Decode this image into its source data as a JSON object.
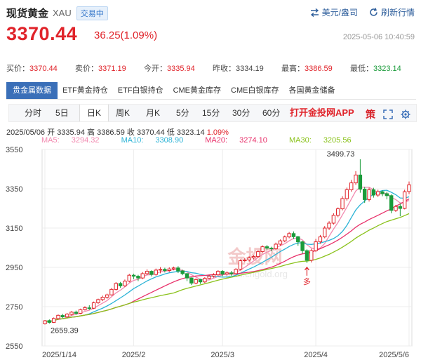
{
  "header": {
    "title": "现货黄金",
    "code": "XAU",
    "status_badge": "交易中",
    "currency_label": "美元/盎司",
    "refresh_label": "刷新行情",
    "last_price": "3370.44",
    "change": "36.25(1.09%)",
    "datetime": "2025-05-06 10:40:59",
    "colors": {
      "up": "#e0232a",
      "down": "#1a9b3a",
      "accent": "#3a6fb8"
    }
  },
  "quotes": {
    "buy_label": "买价：",
    "buy": "3370.44",
    "sell_label": "卖价：",
    "sell": "3371.19",
    "open_label": "今开：",
    "open": "3335.94",
    "prev_label": "昨收：",
    "prev": "3334.19",
    "high_label": "最高：",
    "high": "3386.59",
    "low_label": "最低：",
    "low": "3323.14"
  },
  "tabs": [
    {
      "label": "贵金属数据",
      "active": true
    },
    {
      "label": "ETF黄金持仓"
    },
    {
      "label": "ETF白银持仓"
    },
    {
      "label": "CME黄金库存"
    },
    {
      "label": "CME白银库存"
    },
    {
      "label": "各国黄金储备"
    }
  ],
  "periods": [
    "分时",
    "5日",
    "日K",
    "周K",
    "月K",
    "5分",
    "15分",
    "30分",
    "60分"
  ],
  "active_period": "日K",
  "promo": "打开金投网APP",
  "icons": [
    "ce-icon",
    "fullscreen-icon",
    "settings-icon"
  ],
  "ce_glyph": "策",
  "ohlc": {
    "date": "2025/05/06",
    "open_label": "开",
    "open": "3335.94",
    "high_label": "高",
    "high": "3386.59",
    "close_label": "收",
    "close": "3370.44",
    "low_label": "低",
    "low": "3323.14",
    "change": "1.09%"
  },
  "ma_legend": [
    {
      "label": "MA5:",
      "value": "3294.32",
      "color": "#f28ab0"
    },
    {
      "label": "MA10:",
      "value": "3308.90",
      "color": "#2bb3d6"
    },
    {
      "label": "MA20:",
      "value": "3274.10",
      "color": "#e8306a"
    },
    {
      "label": "MA30:",
      "value": "3205.56",
      "color": "#8ac21b"
    }
  ],
  "watermark": {
    "text": "金投网",
    "sub": "gold.cngold.org"
  },
  "chart_data": {
    "type": "candlestick",
    "y_ticks": [
      "3550",
      "3350",
      "3150",
      "2950",
      "2750",
      "2550"
    ],
    "y_tick_values": [
      3550,
      3350,
      3150,
      2950,
      2750,
      2550
    ],
    "ylim": [
      2550,
      3550
    ],
    "x_ticks": [
      "2025/1/14",
      "2025/2",
      "2025/3",
      "2025/4",
      "2025/5/6"
    ],
    "x_tick_index": [
      0,
      20,
      40,
      61,
      82
    ],
    "max_label": "3499.73",
    "min_label": "2659.39",
    "marker_label": "多",
    "marker_index": 59,
    "candles": [
      [
        2663,
        2678,
        2659,
        2682
      ],
      [
        2679,
        2670,
        2664,
        2685
      ],
      [
        2670,
        2690,
        2667,
        2695
      ],
      [
        2689,
        2706,
        2683,
        2710
      ],
      [
        2705,
        2698,
        2692,
        2714
      ],
      [
        2698,
        2712,
        2693,
        2718
      ],
      [
        2711,
        2722,
        2705,
        2728
      ],
      [
        2722,
        2716,
        2709,
        2730
      ],
      [
        2716,
        2735,
        2712,
        2740
      ],
      [
        2735,
        2745,
        2730,
        2752
      ],
      [
        2744,
        2742,
        2734,
        2757
      ],
      [
        2742,
        2770,
        2738,
        2776
      ],
      [
        2770,
        2786,
        2764,
        2791
      ],
      [
        2786,
        2798,
        2778,
        2806
      ],
      [
        2798,
        2810,
        2790,
        2816
      ],
      [
        2810,
        2838,
        2806,
        2845
      ],
      [
        2838,
        2868,
        2832,
        2875
      ],
      [
        2868,
        2856,
        2846,
        2876
      ],
      [
        2856,
        2880,
        2850,
        2888
      ],
      [
        2880,
        2910,
        2874,
        2917
      ],
      [
        2910,
        2905,
        2890,
        2918
      ],
      [
        2905,
        2896,
        2880,
        2912
      ],
      [
        2896,
        2918,
        2890,
        2926
      ],
      [
        2918,
        2930,
        2910,
        2940
      ],
      [
        2930,
        2914,
        2904,
        2935
      ],
      [
        2914,
        2936,
        2908,
        2944
      ],
      [
        2936,
        2940,
        2920,
        2951
      ],
      [
        2940,
        2934,
        2924,
        2948
      ],
      [
        2934,
        2942,
        2926,
        2950
      ],
      [
        2942,
        2947,
        2935,
        2954
      ],
      [
        2947,
        2932,
        2921,
        2956
      ],
      [
        2932,
        2918,
        2910,
        2938
      ],
      [
        2918,
        2896,
        2880,
        2922
      ],
      [
        2896,
        2870,
        2860,
        2899
      ],
      [
        2870,
        2888,
        2864,
        2894
      ],
      [
        2888,
        2876,
        2866,
        2892
      ],
      [
        2876,
        2894,
        2870,
        2900
      ],
      [
        2894,
        2905,
        2890,
        2912
      ],
      [
        2905,
        2912,
        2898,
        2920
      ],
      [
        2912,
        2930,
        2906,
        2936
      ],
      [
        2930,
        2916,
        2905,
        2936
      ],
      [
        2916,
        2922,
        2908,
        2930
      ],
      [
        2922,
        2918,
        2908,
        2932
      ],
      [
        2918,
        2940,
        2912,
        2946
      ],
      [
        2940,
        2984,
        2934,
        2990
      ],
      [
        2984,
        2988,
        2976,
        2998
      ],
      [
        2988,
        2998,
        2980,
        3006
      ],
      [
        2998,
        3005,
        2990,
        3012
      ],
      [
        3005,
        3030,
        2998,
        3038
      ],
      [
        3030,
        3055,
        3024,
        3062
      ],
      [
        3055,
        3048,
        3040,
        3064
      ],
      [
        3048,
        3045,
        3032,
        3055
      ],
      [
        3045,
        3068,
        3040,
        3076
      ],
      [
        3068,
        3085,
        3060,
        3092
      ],
      [
        3085,
        3105,
        3078,
        3112
      ],
      [
        3105,
        3122,
        3098,
        3130
      ],
      [
        3122,
        3106,
        3094,
        3133
      ],
      [
        3106,
        3080,
        3060,
        3110
      ],
      [
        3080,
        3035,
        3020,
        3086
      ],
      [
        3035,
        2986,
        2972,
        3042
      ],
      [
        2986,
        3035,
        2975,
        3045
      ],
      [
        3035,
        3080,
        3028,
        3095
      ],
      [
        3080,
        3105,
        3070,
        3115
      ],
      [
        3105,
        3150,
        3098,
        3160
      ],
      [
        3150,
        3175,
        3140,
        3185
      ],
      [
        3175,
        3215,
        3168,
        3225
      ],
      [
        3215,
        3248,
        3205,
        3255
      ],
      [
        3248,
        3300,
        3240,
        3312
      ],
      [
        3300,
        3345,
        3290,
        3356
      ],
      [
        3345,
        3380,
        3335,
        3395
      ],
      [
        3380,
        3420,
        3370,
        3440
      ],
      [
        3420,
        3348,
        3330,
        3500
      ],
      [
        3348,
        3295,
        3278,
        3360
      ],
      [
        3295,
        3345,
        3285,
        3355
      ],
      [
        3345,
        3318,
        3305,
        3355
      ],
      [
        3318,
        3335,
        3308,
        3345
      ],
      [
        3335,
        3325,
        3312,
        3342
      ],
      [
        3325,
        3315,
        3296,
        3335
      ],
      [
        3315,
        3240,
        3225,
        3322
      ],
      [
        3240,
        3260,
        3232,
        3268
      ],
      [
        3260,
        3250,
        3210,
        3275
      ],
      [
        3250,
        3335,
        3245,
        3345
      ],
      [
        3336,
        3370,
        3323,
        3387
      ]
    ],
    "ma_series": [
      {
        "name": "MA5",
        "color": "#f28ab0",
        "window": 5
      },
      {
        "name": "MA10",
        "color": "#2bb3d6",
        "window": 10
      },
      {
        "name": "MA20",
        "color": "#e8306a",
        "window": 20
      },
      {
        "name": "MA30",
        "color": "#8ac21b",
        "window": 30
      }
    ]
  }
}
